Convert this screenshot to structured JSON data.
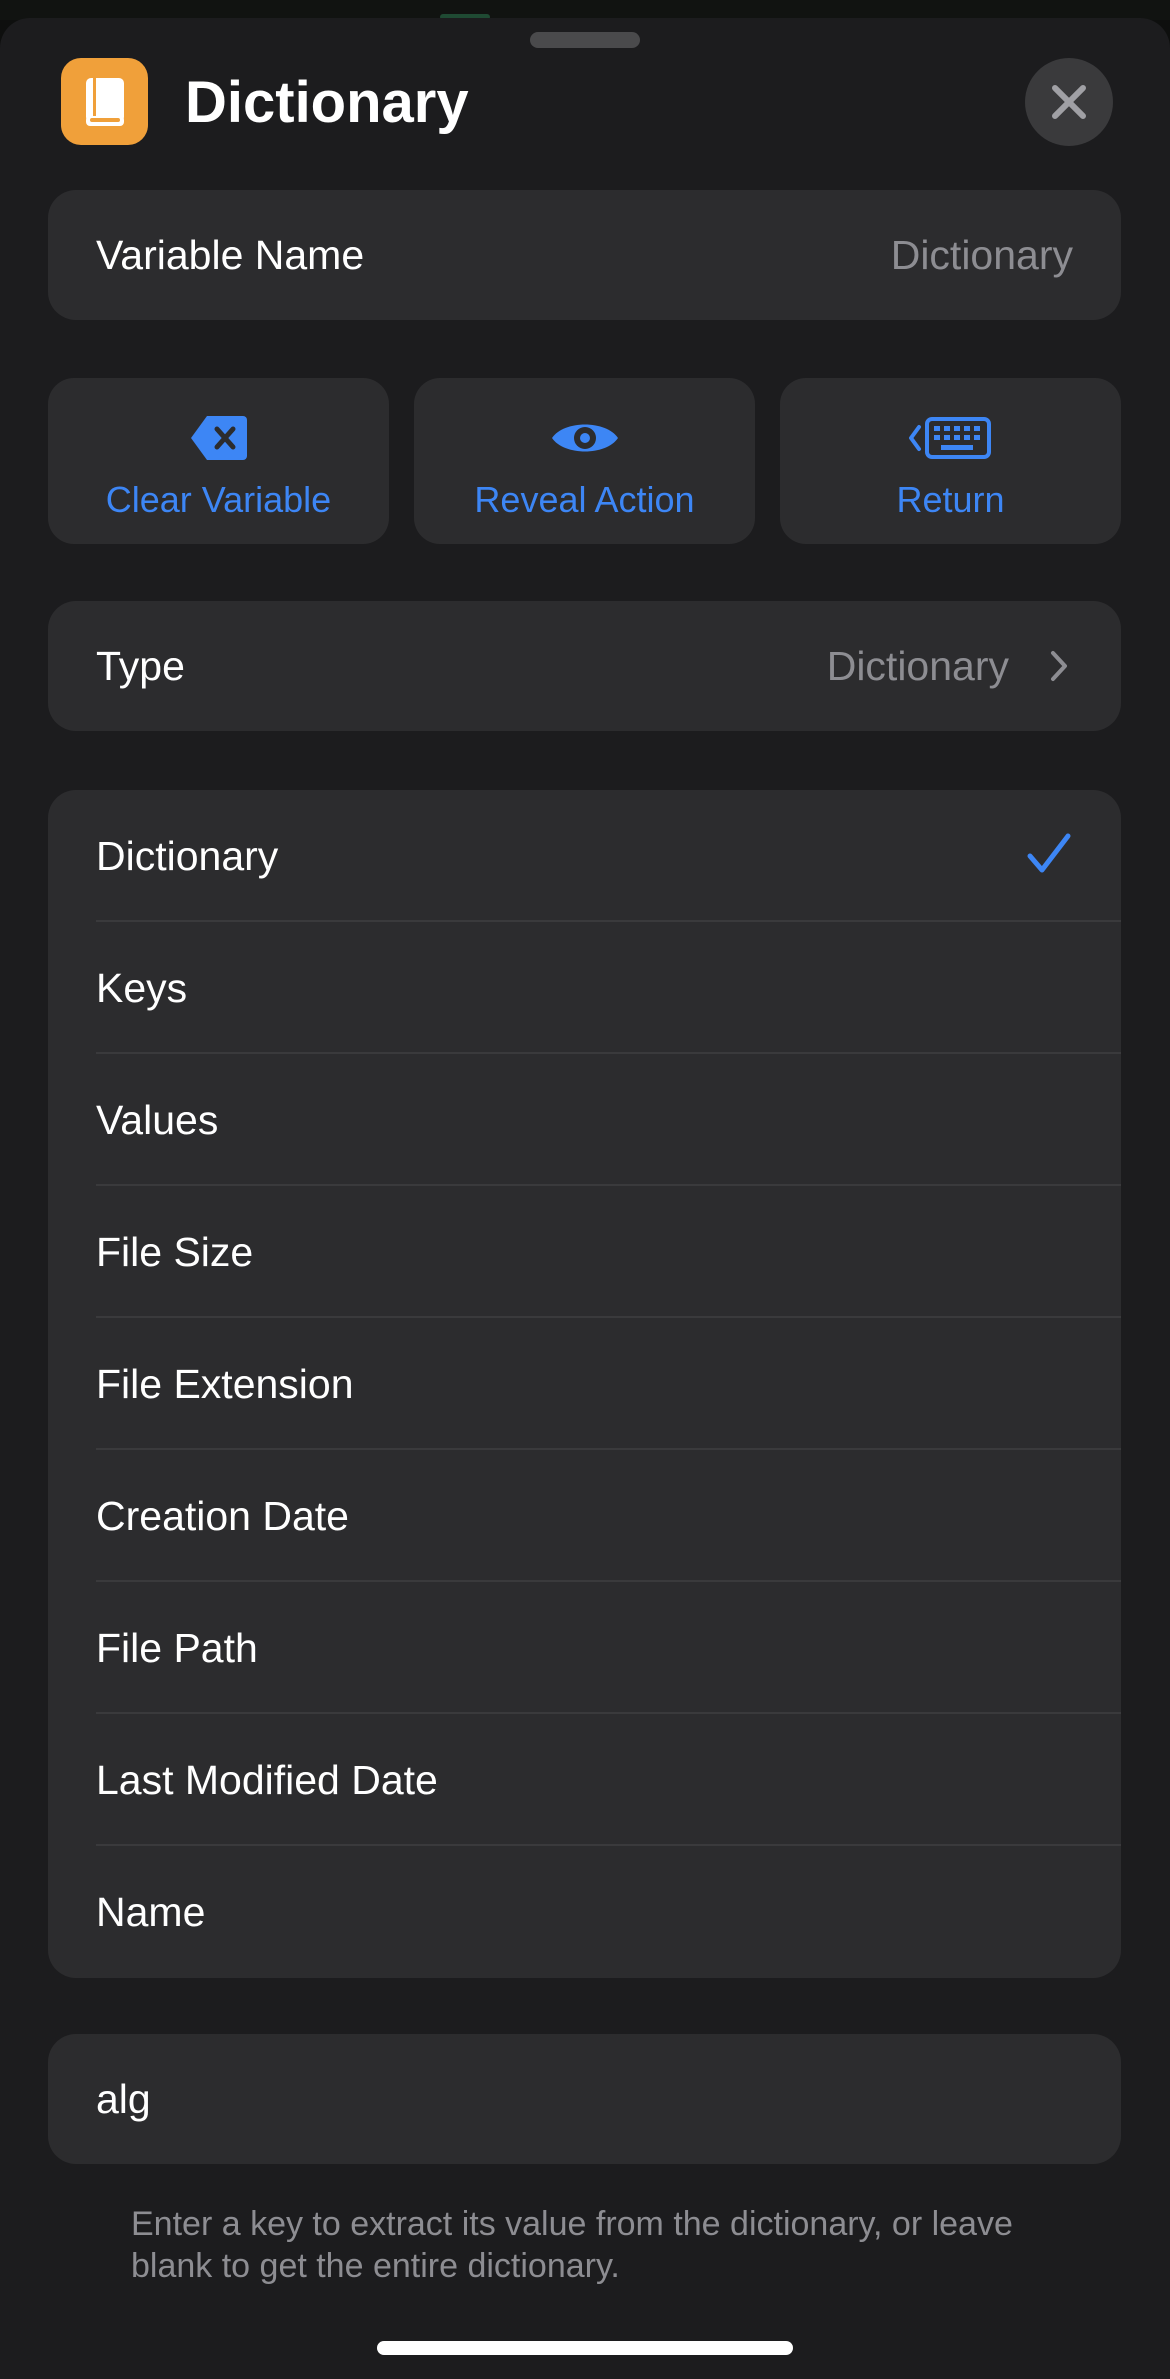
{
  "header": {
    "title": "Dictionary",
    "app_icon": "book-icon",
    "close_icon": "close-icon"
  },
  "variable_name": {
    "label": "Variable Name",
    "placeholder": "Dictionary"
  },
  "actions": [
    {
      "label": "Clear Variable",
      "icon": "delete-left-icon"
    },
    {
      "label": "Reveal Action",
      "icon": "eye-icon"
    },
    {
      "label": "Return",
      "icon": "keyboard-icon"
    }
  ],
  "type_row": {
    "label": "Type",
    "value": "Dictionary"
  },
  "type_options": [
    {
      "label": "Dictionary",
      "selected": true
    },
    {
      "label": "Keys",
      "selected": false
    },
    {
      "label": "Values",
      "selected": false
    },
    {
      "label": "File Size",
      "selected": false
    },
    {
      "label": "File Extension",
      "selected": false
    },
    {
      "label": "Creation Date",
      "selected": false
    },
    {
      "label": "File Path",
      "selected": false
    },
    {
      "label": "Last Modified Date",
      "selected": false
    },
    {
      "label": "Name",
      "selected": false
    }
  ],
  "key_field": {
    "value": "alg"
  },
  "footer": {
    "hint": "Enter a key to extract its value from the dictionary, or leave blank to get the entire dictionary."
  },
  "colors": {
    "accent": "#3d86f5",
    "sheet_bg": "#1c1c1e",
    "card_bg": "#2c2c2e",
    "app_icon_bg": "#f0a03a"
  }
}
